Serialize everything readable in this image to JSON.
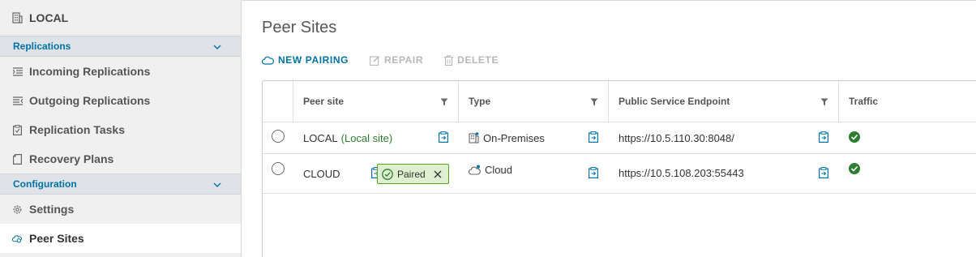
{
  "sidebar": {
    "title": "LOCAL",
    "sections": [
      {
        "label": "Replications",
        "items": [
          {
            "label": "Incoming Replications",
            "icon": "incoming-icon"
          },
          {
            "label": "Outgoing Replications",
            "icon": "outgoing-icon"
          },
          {
            "label": "Replication Tasks",
            "icon": "clipboard-icon"
          },
          {
            "label": "Recovery Plans",
            "icon": "document-icon"
          }
        ]
      },
      {
        "label": "Configuration",
        "items": [
          {
            "label": "Settings",
            "icon": "gear-icon"
          },
          {
            "label": "Peer Sites",
            "icon": "cloud-pair-icon",
            "active": true
          }
        ]
      }
    ]
  },
  "main": {
    "title": "Peer Sites",
    "toolbar": {
      "new_pairing": "NEW PAIRING",
      "repair": "REPAIR",
      "delete": "DELETE"
    },
    "grid": {
      "columns": [
        "Peer site",
        "Type",
        "Public Service Endpoint",
        "Traffic"
      ],
      "rows": [
        {
          "peer_site": "LOCAL",
          "peer_site_tag": "(Local site)",
          "type": "On-Premises",
          "endpoint": "https://10.5.110.30:8048/",
          "traffic_status": "ok"
        },
        {
          "peer_site": "CLOUD",
          "status_badge": "Paired",
          "type": "Cloud",
          "endpoint": "https://10.5.108.203:55443",
          "traffic_status": "ok"
        }
      ]
    }
  },
  "colors": {
    "accent": "#0072a3",
    "success": "#2e7d32",
    "disabled": "#b8b8b8"
  }
}
